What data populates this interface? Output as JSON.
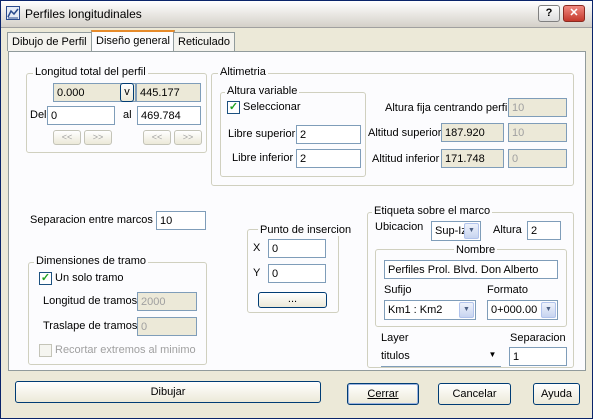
{
  "window": {
    "title": "Perfiles longitudinales",
    "help_icon": "?",
    "close_icon": "✕"
  },
  "tabs": [
    "Dibujo de Perfil",
    "Diseño general",
    "Reticulado"
  ],
  "longitud": {
    "title": "Longitud total del perfil",
    "start_value": "0.000",
    "v_button": "v",
    "end_value": "445.177",
    "del_label": "Del",
    "del_value": "0",
    "al_label": "al",
    "al_value": "469.784",
    "nav_prev": "<<",
    "nav_next": ">>"
  },
  "altimetria": {
    "title": "Altimetria",
    "variable_title": "Altura variable",
    "seleccionar_label": "Seleccionar",
    "seleccionar_checked": true,
    "libre_superior_label": "Libre superior",
    "libre_superior_value": "2",
    "libre_inferior_label": "Libre inferior",
    "libre_inferior_value": "2",
    "altura_fija_label": "Altura fija centrando perfil",
    "altura_fija_value": "10",
    "altitud_superior_label": "Altitud superior",
    "altitud_superior_value": "187.920",
    "altitud_superior_input": "10",
    "altitud_inferior_label": "Altitud inferior",
    "altitud_inferior_value": "171.748",
    "altitud_inferior_input": "0"
  },
  "separacion": {
    "label": "Separacion entre marcos",
    "value": "10"
  },
  "dimensiones": {
    "title": "Dimensiones de tramo",
    "un_solo_tramo_label": "Un solo tramo",
    "un_solo_tramo_checked": true,
    "longitud_label": "Longitud de tramos",
    "longitud_value": "2000",
    "traslape_label": "Traslape de tramos",
    "traslape_value": "0",
    "recortar_label": "Recortar extremos al minimo"
  },
  "punto": {
    "title": "Punto de insercion",
    "x_label": "X",
    "x_value": "0",
    "y_label": "Y",
    "y_value": "0",
    "pick_button": "..."
  },
  "etiqueta": {
    "title": "Etiqueta sobre el marco",
    "ubicacion_label": "Ubicacion",
    "ubicacion_value": "Sup-Izq",
    "altura_label": "Altura",
    "altura_value": "2",
    "nombre_title": "Nombre",
    "nombre_value": "Perfiles Prol. Blvd. Don Alberto",
    "sufijo_label": "Sufijo",
    "sufijo_value": "Km1 : Km2",
    "formato_label": "Formato",
    "formato_value": "0+000.00",
    "layer_label": "Layer",
    "layer_value": "titulos",
    "separacion_label": "Separacion",
    "separacion_value": "1"
  },
  "footer": {
    "dibujar": "Dibujar",
    "cerrar": "Cerrar",
    "cancelar": "Cancelar",
    "ayuda": "Ayuda"
  },
  "icons": {
    "dropdown": "▼",
    "check": "✓"
  },
  "colors": {
    "title_gradient_top": "#ffffff",
    "close_button": "#c4382b",
    "active_tab_accent": "#e68b2c"
  }
}
